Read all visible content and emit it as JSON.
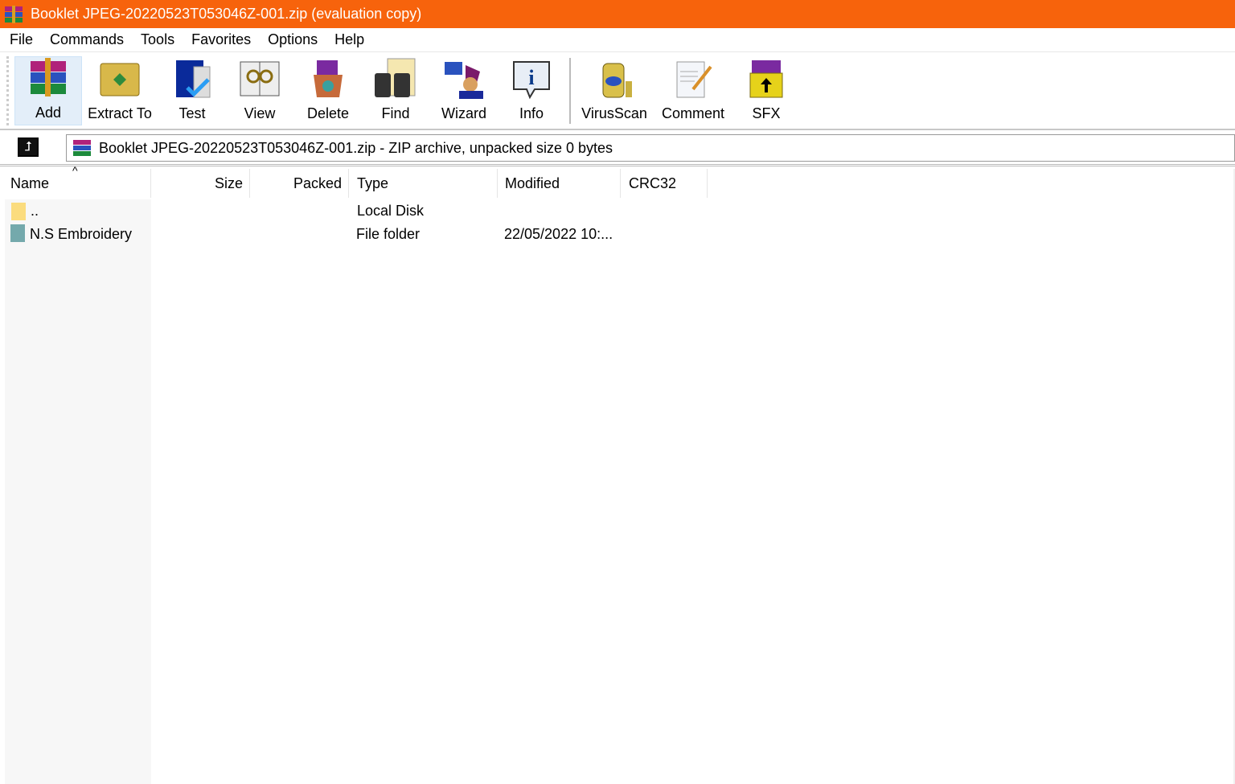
{
  "window": {
    "title": "Booklet JPEG-20220523T053046Z-001.zip (evaluation copy)",
    "accent": "#f7630c"
  },
  "menu": [
    "File",
    "Commands",
    "Tools",
    "Favorites",
    "Options",
    "Help"
  ],
  "toolbar": [
    {
      "label": "Add",
      "icon": "add-archive-icon"
    },
    {
      "label": "Extract To",
      "icon": "extract-icon"
    },
    {
      "label": "Test",
      "icon": "test-icon"
    },
    {
      "label": "View",
      "icon": "view-icon"
    },
    {
      "label": "Delete",
      "icon": "delete-icon"
    },
    {
      "label": "Find",
      "icon": "find-icon"
    },
    {
      "label": "Wizard",
      "icon": "wizard-icon"
    },
    {
      "label": "Info",
      "icon": "info-icon"
    },
    {
      "label": "VirusScan",
      "icon": "virusscan-icon"
    },
    {
      "label": "Comment",
      "icon": "comment-icon"
    },
    {
      "label": "SFX",
      "icon": "sfx-icon"
    }
  ],
  "address": {
    "text": "Booklet JPEG-20220523T053046Z-001.zip - ZIP archive, unpacked size 0 bytes"
  },
  "columns": [
    "Name",
    "Size",
    "Packed",
    "Type",
    "Modified",
    "CRC32"
  ],
  "rows": [
    {
      "name": "..",
      "size": "",
      "packed": "",
      "type": "Local Disk",
      "modified": "",
      "crc": "",
      "selected": false
    },
    {
      "name": "N.S Embroidery",
      "size": "",
      "packed": "",
      "type": "File folder",
      "modified": "22/05/2022 10:...",
      "crc": "",
      "selected": true
    }
  ],
  "selection_color": "#0b78d7"
}
